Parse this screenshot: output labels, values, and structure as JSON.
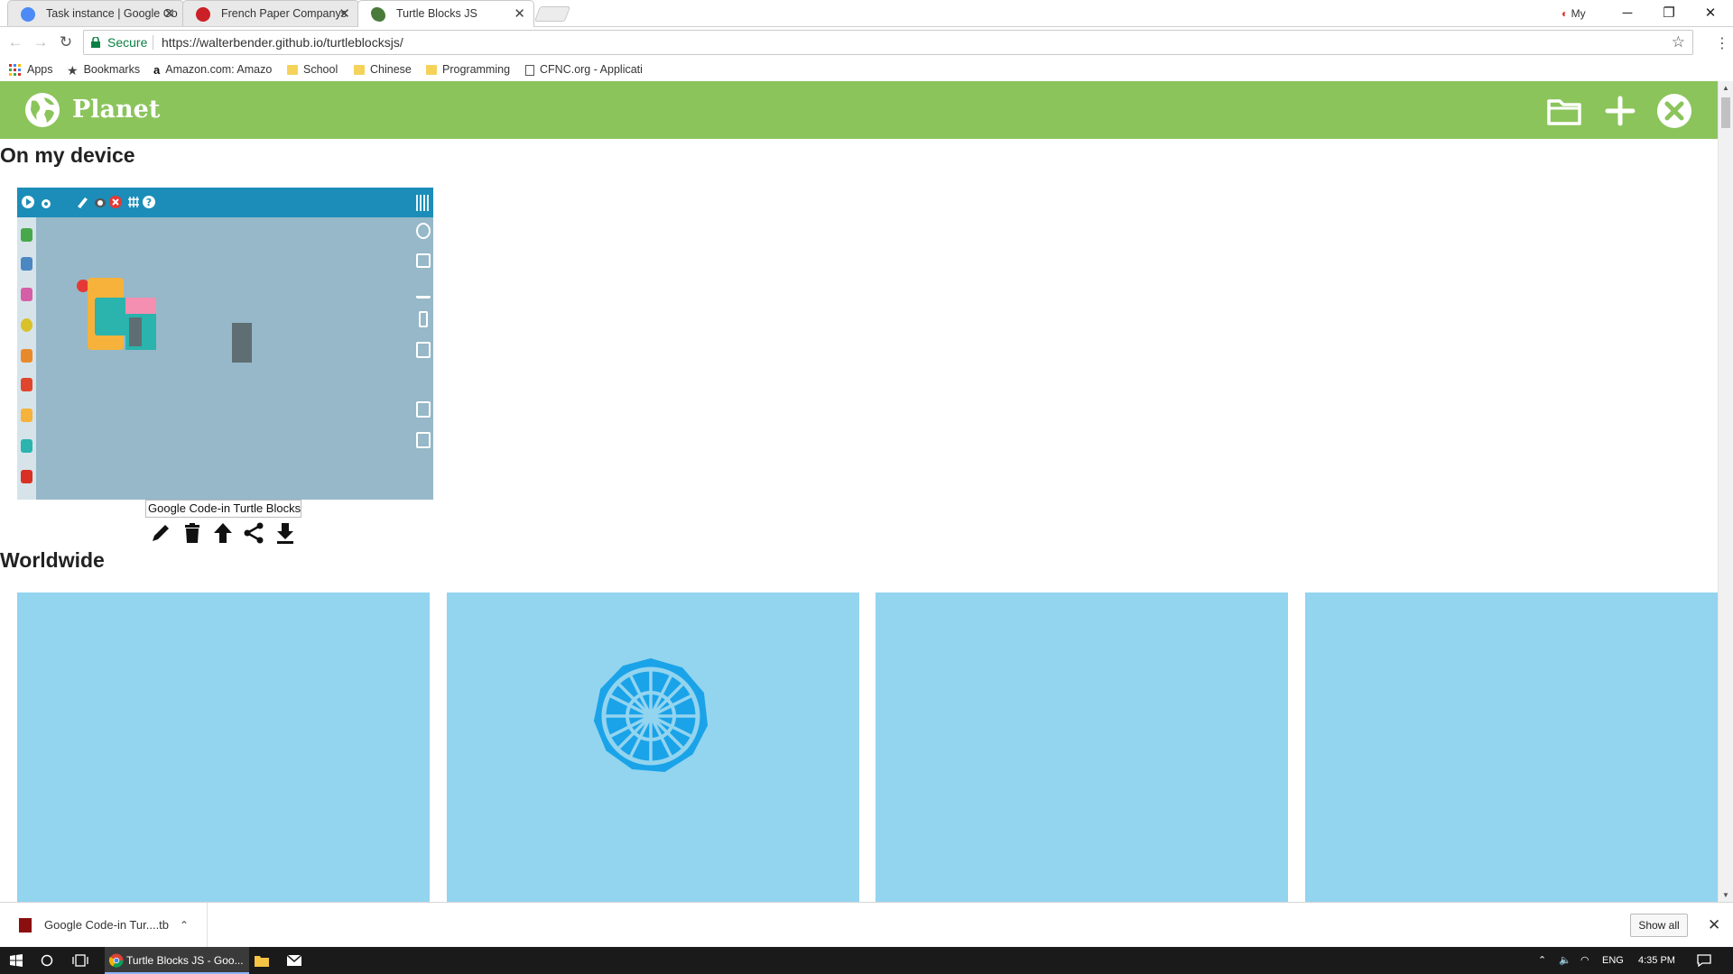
{
  "browser": {
    "tabs": [
      {
        "title": "Task instance | Google Co",
        "icon": "gear-icon"
      },
      {
        "title": "French Paper Companys",
        "icon": "pinterest-icon"
      },
      {
        "title": "Turtle Blocks JS",
        "icon": "turtle-icon"
      }
    ],
    "profile_label": "My",
    "secure_label": "Secure",
    "url": "https://walterbender.github.io/turtleblocksjs/",
    "bookmarks": [
      {
        "label": "Apps",
        "icon": "apps-grid-icon"
      },
      {
        "label": "Bookmarks",
        "icon": "star-icon"
      },
      {
        "label": "Amazon.com: Amazo",
        "icon": "amazon-icon"
      },
      {
        "label": "School",
        "icon": "folder-icon"
      },
      {
        "label": "Chinese",
        "icon": "folder-icon"
      },
      {
        "label": "Programming",
        "icon": "folder-icon"
      },
      {
        "label": "CFNC.org - Applicati",
        "icon": "page-icon"
      }
    ]
  },
  "planet": {
    "title": "Planet",
    "header_colour": "#8bc45b",
    "header_icons": [
      "open-folder-icon",
      "new-project-icon",
      "close-icon"
    ]
  },
  "local": {
    "heading": "On my device",
    "project": {
      "name": "Google Code-in Turtle Blocks",
      "actions": [
        "edit-icon",
        "delete-icon",
        "publish-icon",
        "share-icon",
        "download-icon"
      ]
    }
  },
  "worldwide": {
    "heading": "Worldwide",
    "card_colour": "#93d4ef",
    "cards": [
      {
        "artwork": "none"
      },
      {
        "artwork": "star-polygon"
      },
      {
        "artwork": "none"
      },
      {
        "artwork": "none"
      }
    ]
  },
  "downloads": {
    "file": "Google Code-in Tur....tb",
    "show_all": "Show all"
  },
  "taskbar": {
    "active_app": "Turtle Blocks JS - Goo...",
    "language": "ENG",
    "time": "4:35 PM"
  }
}
